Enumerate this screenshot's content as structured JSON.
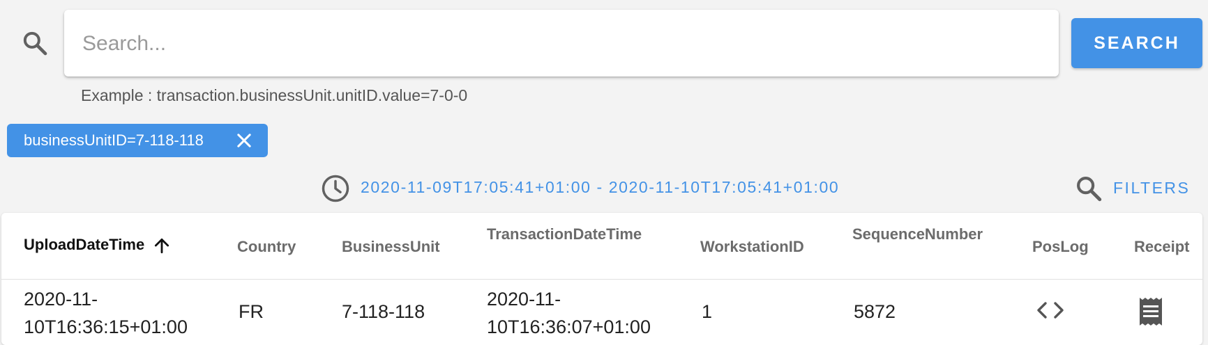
{
  "search": {
    "placeholder": "Search...",
    "button_label": "SEARCH",
    "example": "Example : transaction.businessUnit.unitID.value=7-0-0"
  },
  "active_filter": {
    "label": "businessUnitID=7-118-118"
  },
  "date_range": {
    "text": "2020-11-09T17:05:41+01:00 - 2020-11-10T17:05:41+01:00"
  },
  "filters": {
    "label": "FILTERS"
  },
  "table": {
    "columns": {
      "upload": "UploadDateTime",
      "country": "Country",
      "business_unit": "BusinessUnit",
      "transaction": "TransactionDateTime",
      "workstation": "WorkstationID",
      "sequence": "SequenceNumber",
      "poslog": "PosLog",
      "receipt": "Receipt"
    },
    "rows": [
      {
        "upload_line1": "2020-11-",
        "upload_line2": "10T16:36:15+01:00",
        "country": "FR",
        "business_unit": "7-118-118",
        "transaction_line1": "2020-11-",
        "transaction_line2": "10T16:36:07+01:00",
        "workstation": "1",
        "sequence": "5872"
      }
    ]
  },
  "colors": {
    "accent": "#4392e6",
    "background": "#f3f3f3"
  },
  "icons": {
    "search": "search-icon",
    "close": "close-icon",
    "clock": "clock-icon",
    "filters": "search-icon",
    "sort": "arrow-up-icon",
    "poslog": "code-icon",
    "receipt": "receipt-icon"
  }
}
